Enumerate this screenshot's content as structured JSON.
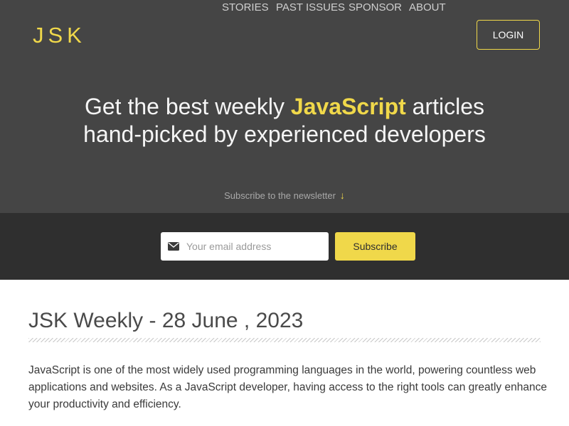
{
  "brand": {
    "logo": "JSK",
    "accent_color": "#f0d84a",
    "hero_bg": "#454545",
    "band_bg": "#2f2f2f"
  },
  "nav": {
    "items": [
      {
        "label": "STORIES"
      },
      {
        "label": "PAST ISSUES"
      },
      {
        "label": "SPONSOR"
      },
      {
        "label": "ABOUT"
      }
    ],
    "login_label": "LOGIN"
  },
  "hero": {
    "headline_pre": "Get the best weekly ",
    "headline_highlight": "JavaScript",
    "headline_post": " articles",
    "headline_line2": "hand-picked by experienced developers",
    "subscribe_prompt": "Subscribe to the newsletter",
    "arrow_icon": "arrow-down-icon"
  },
  "subscribe": {
    "email_placeholder": "Your email address",
    "email_value": "",
    "email_icon": "envelope-icon",
    "button_label": "Subscribe"
  },
  "main": {
    "issue_title": "JSK Weekly - 28 June , 2023",
    "intro": "JavaScript is one of the most widely used programming languages in the world, powering countless web applications and websites. As a JavaScript developer, having access to the right tools can greatly enhance your productivity and efficiency."
  }
}
